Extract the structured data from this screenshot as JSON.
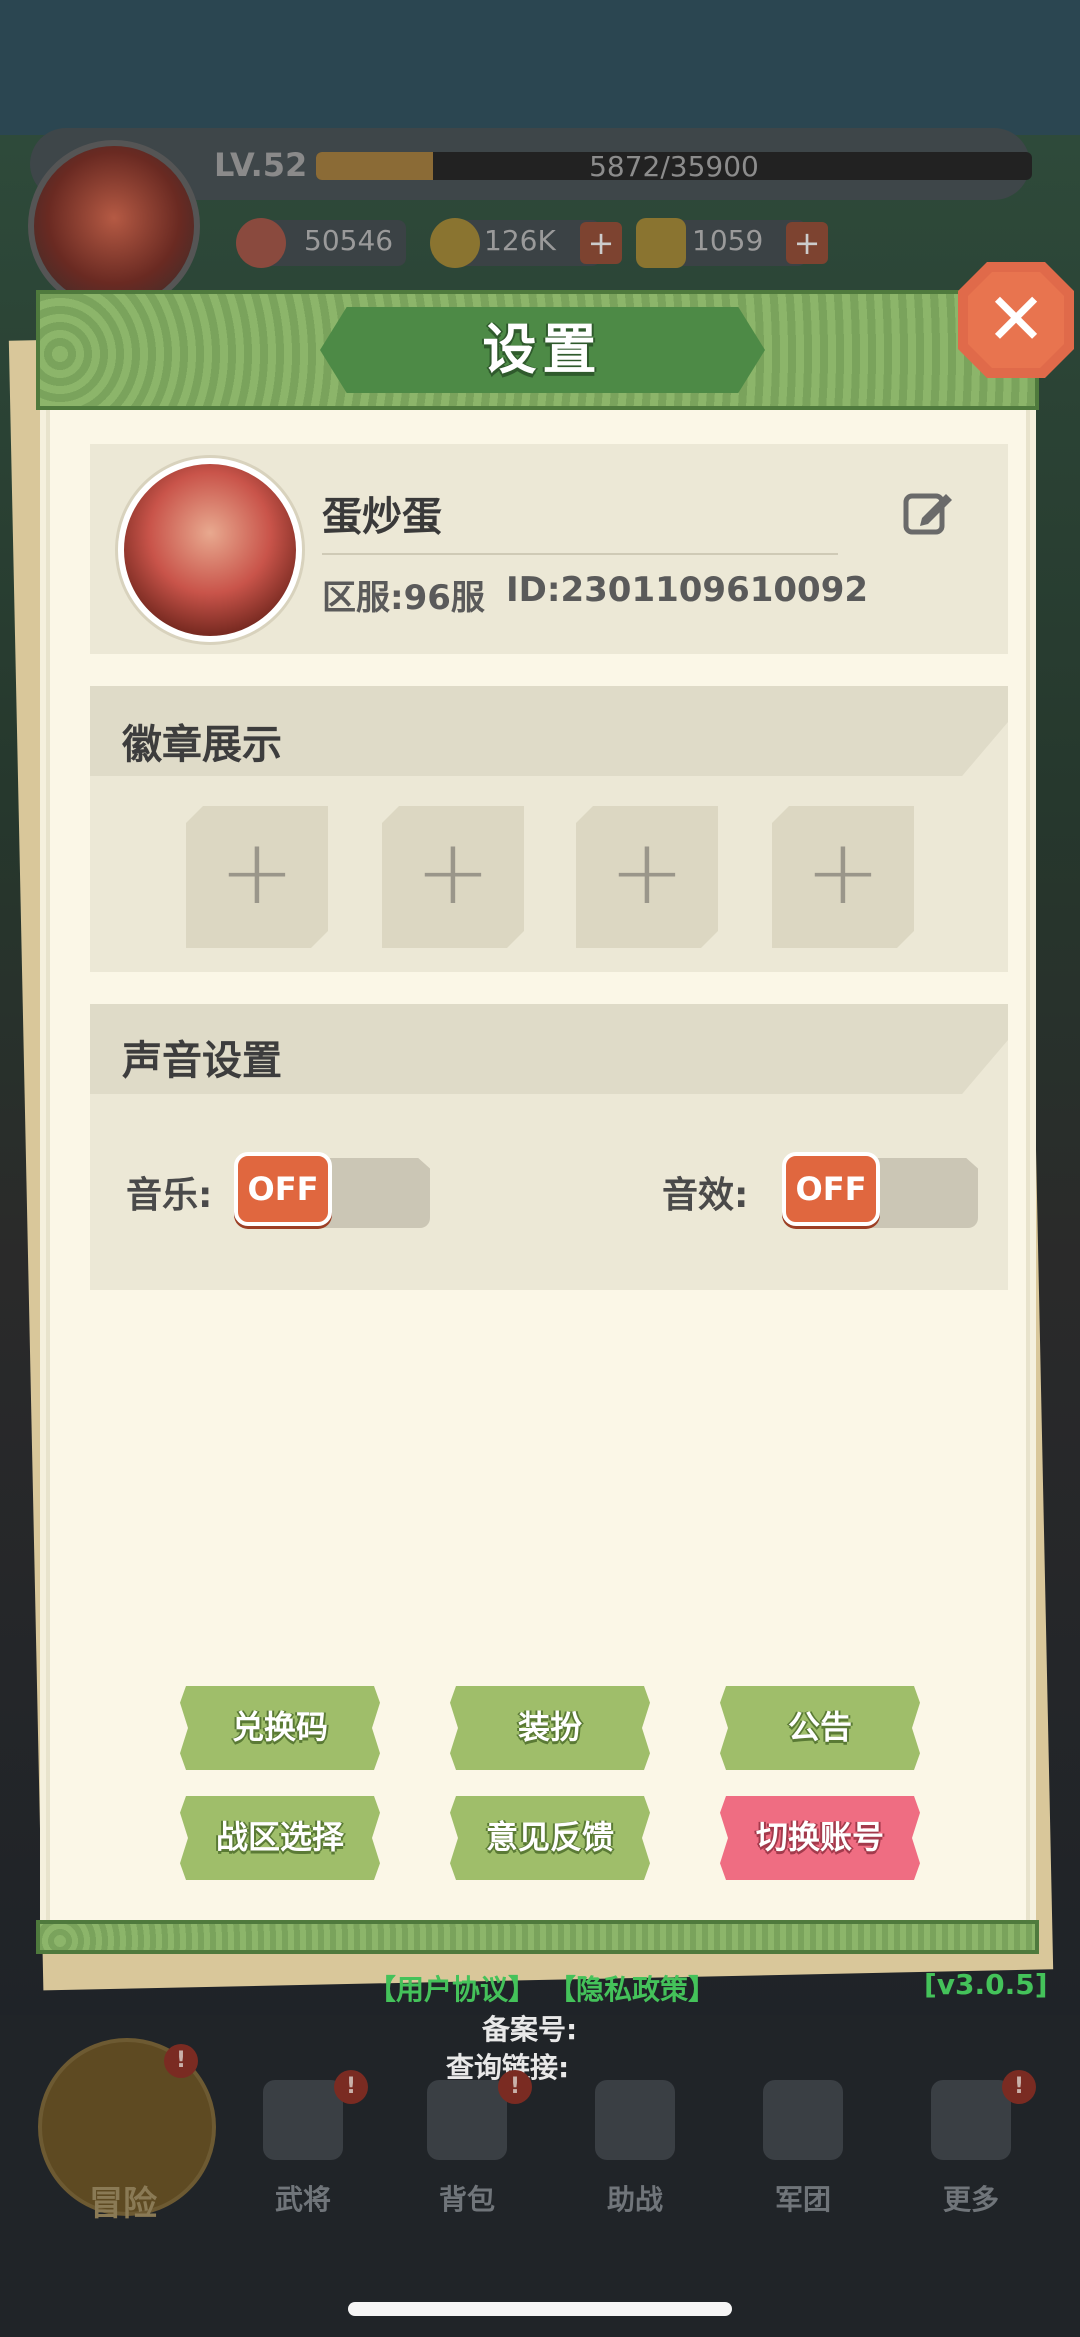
{
  "top_bar": {
    "level": "LV.52",
    "xp_text": "5872/35900",
    "xp_progress": 0.1635,
    "power": "50546",
    "gold": "126K",
    "ingot": "1059",
    "plus": "+"
  },
  "dialog": {
    "title": "设置",
    "close_label": "✕",
    "profile": {
      "name": "蛋炒蛋",
      "server": "区服:96服",
      "id": "ID:2301109610092"
    },
    "badges": {
      "title": "徽章展示",
      "slots": [
        "+",
        "+",
        "+",
        "+"
      ]
    },
    "sound": {
      "title": "声音设置",
      "music_label": "音乐:",
      "music_state": "OFF",
      "sfx_label": "音效:",
      "sfx_state": "OFF"
    },
    "buttons": {
      "redeem": "兑换码",
      "dress": "装扮",
      "notice": "公告",
      "server_select": "战区选择",
      "feedback": "意见反馈",
      "switch_account": "切换账号"
    }
  },
  "footer": {
    "user_agreement": "【用户协议】",
    "privacy": "【隐私政策】",
    "version": "[v3.0.5]",
    "record_no": "备案号:",
    "query_link": "查询链接:"
  },
  "bottom_nav": {
    "adventure": "冒险",
    "generals": "武将",
    "bag": "背包",
    "assist": "助战",
    "legion": "军团",
    "more": "更多",
    "alert": "!"
  },
  "colors": {
    "accent_green": "#4d8a46",
    "toggle_off": "#e0673f",
    "switch_account": "#ef6d82",
    "link_green": "#44c25a"
  }
}
